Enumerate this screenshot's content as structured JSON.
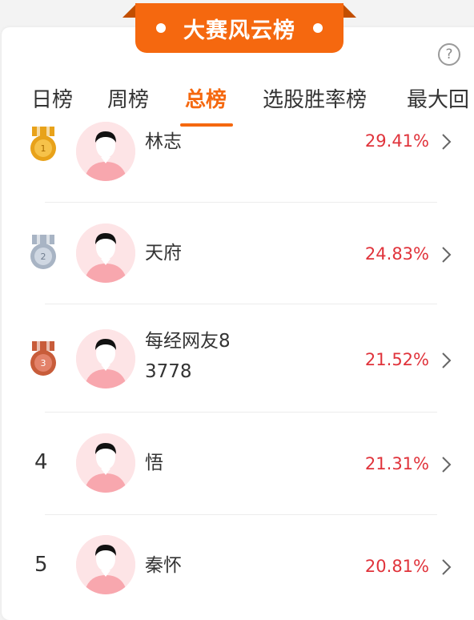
{
  "header": {
    "title": "大赛风云榜"
  },
  "help_icon": "?",
  "tabs": [
    {
      "label": "日榜",
      "active": false
    },
    {
      "label": "周榜",
      "active": false
    },
    {
      "label": "总榜",
      "active": true
    },
    {
      "label": "选股胜率榜",
      "active": false
    },
    {
      "label": "最大回",
      "active": false
    }
  ],
  "ranking": [
    {
      "rank": "1",
      "medal": "gold-medal-icon",
      "name": "林志",
      "rate": "29.41%"
    },
    {
      "rank": "2",
      "medal": "silver-medal-icon",
      "name": "天府",
      "rate": "24.83%"
    },
    {
      "rank": "3",
      "medal": "bronze-medal-icon",
      "name": "每经网友83778",
      "rate": "21.52%"
    },
    {
      "rank": "4",
      "medal": null,
      "name": "悟",
      "rate": "21.31%"
    },
    {
      "rank": "5",
      "medal": null,
      "name": "秦怀",
      "rate": "20.81%"
    }
  ],
  "colors": {
    "accent": "#f5680f",
    "rate_red": "#e0333b",
    "gold": "#e8a21a",
    "silver": "#a8b4c4",
    "bronze": "#c85c3a"
  }
}
